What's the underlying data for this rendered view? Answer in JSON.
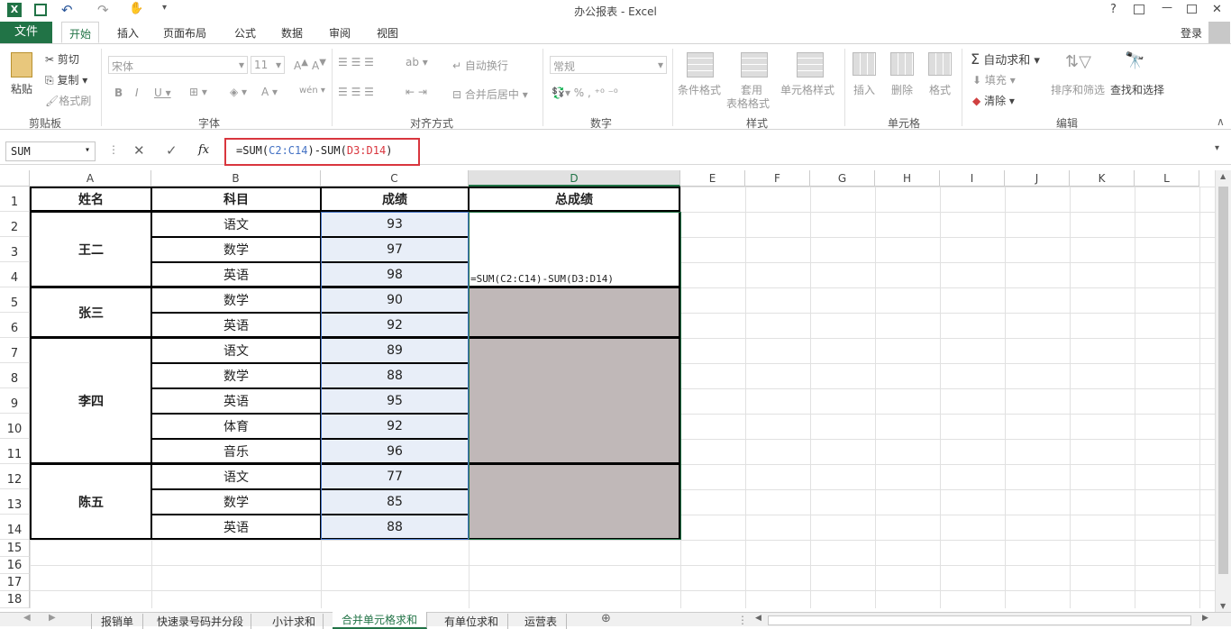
{
  "title": "办公报表 - Excel",
  "window": {
    "help": "?",
    "restore": "🗗",
    "minimize": "—",
    "maximize": "□",
    "close": "✕"
  },
  "file_tab": "文件",
  "tabs": [
    "开始",
    "插入",
    "页面布局",
    "公式",
    "数据",
    "审阅",
    "视图"
  ],
  "login": "登录",
  "ribbon": {
    "paste": "粘贴",
    "cut": "剪切",
    "copy": "复制",
    "format_painter": "格式刷",
    "font_name": "宋体",
    "font_size": "11",
    "wrap_text": "自动换行",
    "merge_center": "合并后居中",
    "number_format": "常规",
    "cond_format": "条件格式",
    "table_format_1": "套用",
    "table_format_2": "表格格式",
    "cell_style": "单元格样式",
    "insert": "插入",
    "delete": "删除",
    "format": "格式",
    "autosum": "自动求和",
    "fill": "填充",
    "clear": "清除",
    "sort_filter": "排序和筛选",
    "find_select": "查找和选择",
    "groups": {
      "clipboard": "剪贴板",
      "font": "字体",
      "alignment": "对齐方式",
      "number": "数字",
      "styles": "样式",
      "cells": "单元格",
      "editing": "编辑"
    }
  },
  "formula_bar": {
    "name_box": "SUM",
    "fx": "fx",
    "formula": "=SUM(C2:C14)-SUM(D3:D14)"
  },
  "columns": [
    "A",
    "B",
    "C",
    "D",
    "E",
    "F",
    "G",
    "H",
    "I",
    "J",
    "K",
    "L"
  ],
  "headers": {
    "name": "姓名",
    "subject": "科目",
    "score": "成绩",
    "total": "总成绩"
  },
  "names": [
    "王二",
    "张三",
    "李四",
    "陈五"
  ],
  "subjects": [
    "语文",
    "数学",
    "英语",
    "数学",
    "英语",
    "语文",
    "数学",
    "英语",
    "体育",
    "音乐",
    "语文",
    "数学",
    "英语"
  ],
  "scores": [
    "93",
    "97",
    "98",
    "90",
    "92",
    "89",
    "88",
    "95",
    "92",
    "96",
    "77",
    "85",
    "88"
  ],
  "d_cell_formula": "=SUM(C2:C14)-SUM(D3:D14)",
  "sheet_tabs": [
    "报销单",
    "快速录号码并分段",
    "小计求和",
    "合并单元格求和",
    "有单位求和",
    "运营表"
  ],
  "colors": {
    "accent": "#217346",
    "selection": "#e8eef8",
    "merged_fill": "#c0b8b8",
    "formula_highlight": "#d9363e"
  }
}
